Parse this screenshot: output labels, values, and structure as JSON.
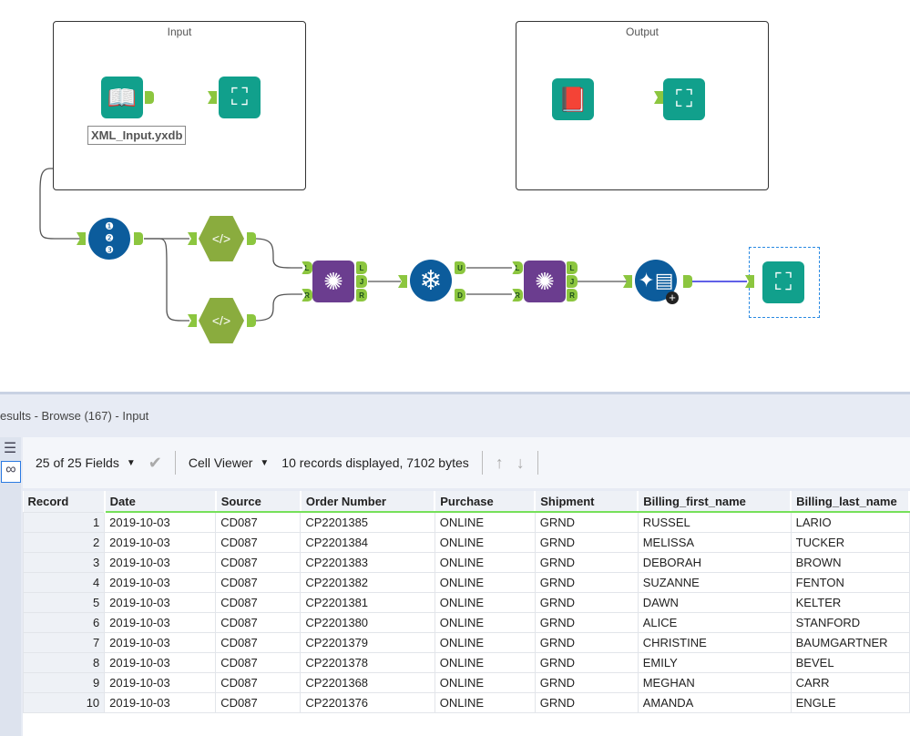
{
  "canvas": {
    "containers": [
      {
        "title": "Input"
      },
      {
        "title": "Output"
      }
    ],
    "annotation": "XML_Input.yxdb",
    "anchors": {
      "L": "L",
      "R": "R",
      "J": "J",
      "U": "U",
      "D": "D"
    },
    "colors": {
      "tool_teal": "#11a08c",
      "anchor_green": "#8cc63f",
      "record_blue": "#0c5c9c",
      "filter_green": "#8aac3e",
      "join_purple": "#6b3d8f",
      "selected_line": "#2b2bdf"
    }
  },
  "results": {
    "title": "esults - Browse (167) - Input",
    "fields_label": "25 of 25 Fields",
    "cell_viewer": "Cell Viewer",
    "status": "10 records displayed, 7102 bytes",
    "columns": [
      "Record",
      "Date",
      "Source",
      "Order Number",
      "Purchase",
      "Shipment",
      "Billing_first_name",
      "Billing_last_name"
    ],
    "rows": [
      [
        "1",
        "2019-10-03",
        "CD087",
        "CP2201385",
        "ONLINE",
        "GRND",
        "RUSSEL",
        "LARIO"
      ],
      [
        "2",
        "2019-10-03",
        "CD087",
        "CP2201384",
        "ONLINE",
        "GRND",
        "MELISSA",
        "TUCKER"
      ],
      [
        "3",
        "2019-10-03",
        "CD087",
        "CP2201383",
        "ONLINE",
        "GRND",
        "DEBORAH",
        "BROWN"
      ],
      [
        "4",
        "2019-10-03",
        "CD087",
        "CP2201382",
        "ONLINE",
        "GRND",
        "SUZANNE",
        "FENTON"
      ],
      [
        "5",
        "2019-10-03",
        "CD087",
        "CP2201381",
        "ONLINE",
        "GRND",
        "DAWN",
        "KELTER"
      ],
      [
        "6",
        "2019-10-03",
        "CD087",
        "CP2201380",
        "ONLINE",
        "GRND",
        "ALICE",
        "STANFORD"
      ],
      [
        "7",
        "2019-10-03",
        "CD087",
        "CP2201379",
        "ONLINE",
        "GRND",
        "CHRISTINE",
        "BAUMGARTNER"
      ],
      [
        "8",
        "2019-10-03",
        "CD087",
        "CP2201378",
        "ONLINE",
        "GRND",
        "EMILY",
        "BEVEL"
      ],
      [
        "9",
        "2019-10-03",
        "CD087",
        "CP2201368",
        "ONLINE",
        "GRND",
        "MEGHAN",
        "CARR"
      ],
      [
        "10",
        "2019-10-03",
        "CD087",
        "CP2201376",
        "ONLINE",
        "GRND",
        "AMANDA",
        "ENGLE"
      ]
    ]
  }
}
